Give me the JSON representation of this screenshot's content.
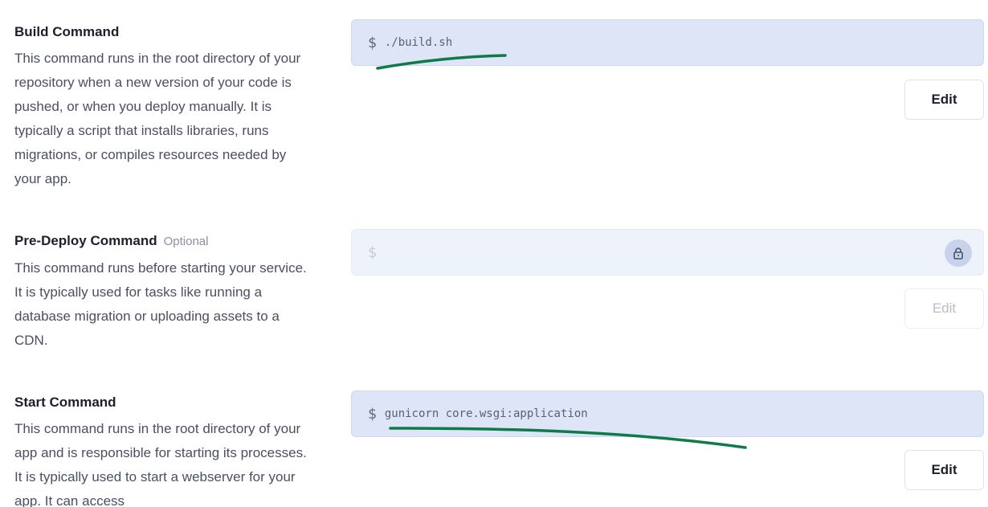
{
  "sections": [
    {
      "title": "Build Command",
      "optional": "",
      "description": "This command runs in the root directory of your repository when a new version of your code is pushed, or when you deploy manually. It is typically a script that installs libraries, runs migrations, or compiles resources needed by your app.",
      "prompt": "$",
      "command": "./build.sh",
      "edit_label": "Edit",
      "state": "editable"
    },
    {
      "title": "Pre-Deploy Command",
      "optional": "Optional",
      "description": "This command runs before starting your service. It is typically used for tasks like running a database migration or uploading assets to a CDN.",
      "prompt": "$",
      "command": "",
      "edit_label": "Edit",
      "state": "locked",
      "lock_icon": "lock-icon"
    },
    {
      "title": "Start Command",
      "optional": "",
      "description": "This command runs in the root directory of your app and is responsible for starting its processes. It is typically used to start a webserver for your app. It can access",
      "prompt": "$",
      "command": "gunicorn core.wsgi:application",
      "edit_label": "Edit",
      "state": "editable"
    }
  ],
  "colors": {
    "annotation_stroke": "#0f7a4a",
    "command_bg": "#dde5f7",
    "command_bg_disabled": "#eef2fb"
  }
}
